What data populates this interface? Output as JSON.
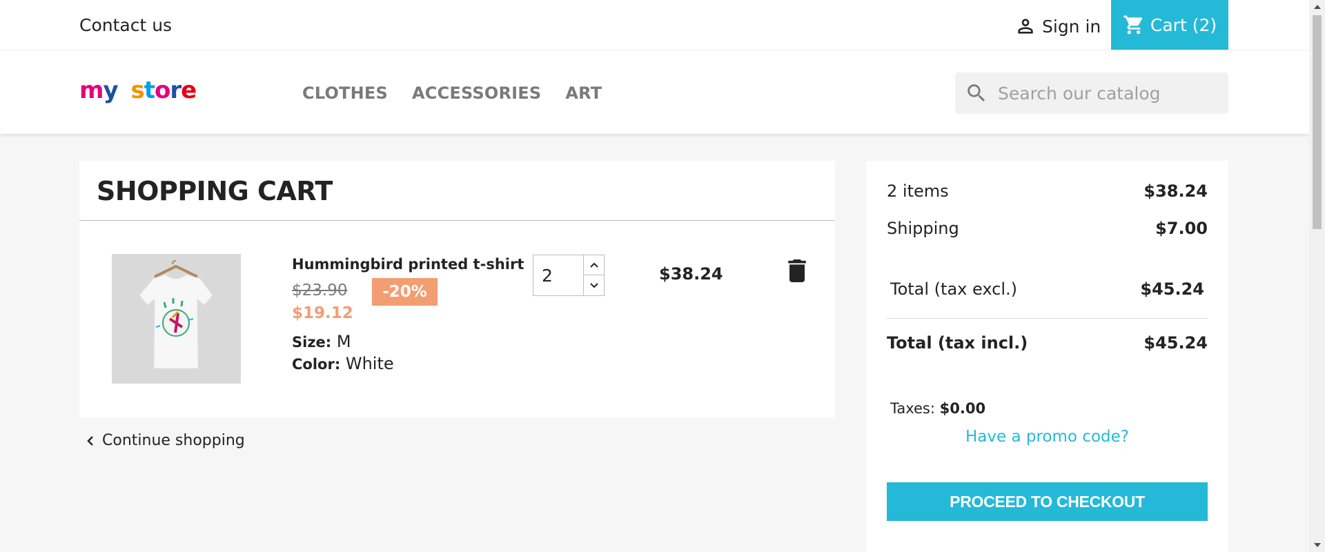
{
  "topnav": {
    "contact": "Contact us",
    "signin": "Sign in",
    "cart": "Cart (2)"
  },
  "header": {
    "logo": {
      "word1": "my",
      "word2": "store"
    },
    "menu": [
      "CLOTHES",
      "ACCESSORIES",
      "ART"
    ],
    "search_placeholder": "Search our catalog"
  },
  "cart": {
    "title": "SHOPPING CART",
    "item": {
      "name": "Hummingbird printed t-shirt",
      "old_price": "$23.90",
      "discount": "-20%",
      "price": "$19.12",
      "size_label": "Size:",
      "size": "M",
      "color_label": "Color:",
      "color": "White",
      "quantity": "2",
      "total": "$38.24"
    },
    "continue": "Continue shopping"
  },
  "summary": {
    "items_label": "2 items",
    "items_value": "$38.24",
    "shipping_label": "Shipping",
    "shipping_value": "$7.00",
    "excl_label": "Total (tax excl.)",
    "excl_value": "$45.24",
    "incl_label": "Total (tax incl.)",
    "incl_value": "$45.24",
    "taxes_label": "Taxes:",
    "taxes_value": "$0.00",
    "promo": "Have a promo code?",
    "checkout": "PROCEED TO CHECKOUT"
  },
  "colors": {
    "accent": "#24b9d7",
    "discount": "#f39d72",
    "background": "#f6f6f6"
  }
}
